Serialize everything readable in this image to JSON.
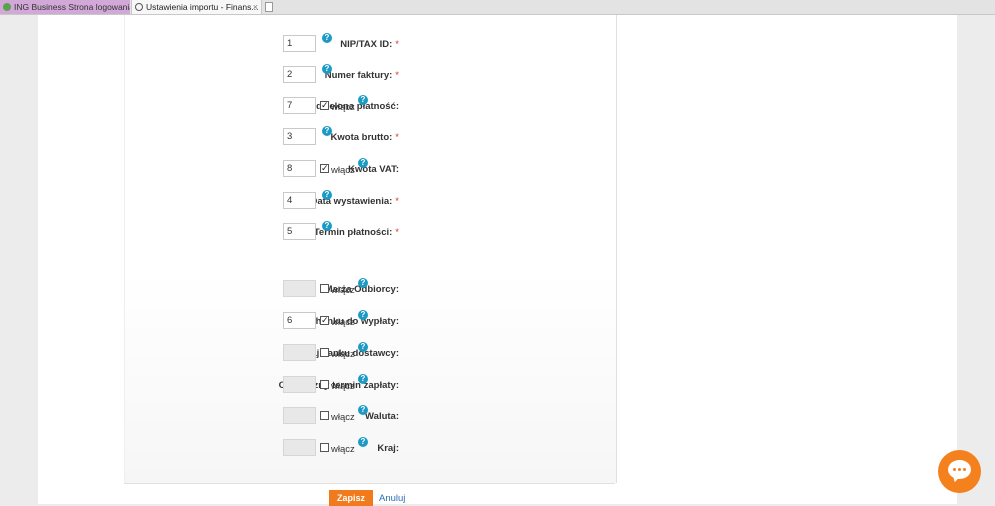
{
  "tabs": [
    {
      "title": "ING Business Strona logowania..."
    },
    {
      "title": "Ustawienia importu - Finans...",
      "close": "×"
    }
  ],
  "fields": [
    {
      "label": "NIP/TAX ID:",
      "required": true,
      "value": "1",
      "toggle": false
    },
    {
      "label": "Numer faktury:",
      "required": true,
      "value": "2",
      "toggle": false
    },
    {
      "label": "Czy podzielona płatność:",
      "required": false,
      "value": "7",
      "toggle": true,
      "checked": true
    },
    {
      "label": "Kwota brutto:",
      "required": true,
      "value": "3",
      "toggle": false
    },
    {
      "label": "Kwota VAT:",
      "required": false,
      "value": "8",
      "toggle": true,
      "checked": true
    },
    {
      "label": "Data wystawienia:",
      "required": true,
      "value": "4",
      "toggle": false
    },
    {
      "label": "Termin płatności:",
      "required": true,
      "value": "5",
      "toggle": false
    },
    {
      "label": "Marża Odbiorcy:",
      "required": false,
      "value": "",
      "toggle": true,
      "checked": false
    },
    {
      "label": "Nr rachunku do wypłaty:",
      "required": false,
      "value": "6",
      "toggle": true,
      "checked": true
    },
    {
      "label": "Kraj banku dostawcy:",
      "required": false,
      "value": "",
      "toggle": true,
      "checked": false
    },
    {
      "label": "Ostateczny termin zapłaty:",
      "required": false,
      "value": "",
      "toggle": true,
      "checked": false
    },
    {
      "label": "Waluta:",
      "required": false,
      "value": "",
      "toggle": true,
      "checked": false
    },
    {
      "label": "Kraj:",
      "required": false,
      "value": "",
      "toggle": true,
      "checked": false
    }
  ],
  "common": {
    "required_mark": "*",
    "toggle_label": "włącz",
    "help_glyph": "?",
    "check_glyph": "✓"
  },
  "actions": {
    "save_label": "Zapisz",
    "cancel_label": "Anuluj"
  },
  "colors": {
    "accent": "#f07a1c",
    "help": "#1b9bc4",
    "link": "#2a6fb5",
    "required": "#e0302a"
  },
  "icons": [
    "browser-favicon-icon",
    "close-icon",
    "new-tab-icon",
    "help-icon",
    "checkbox-icon",
    "chat-icon"
  ]
}
